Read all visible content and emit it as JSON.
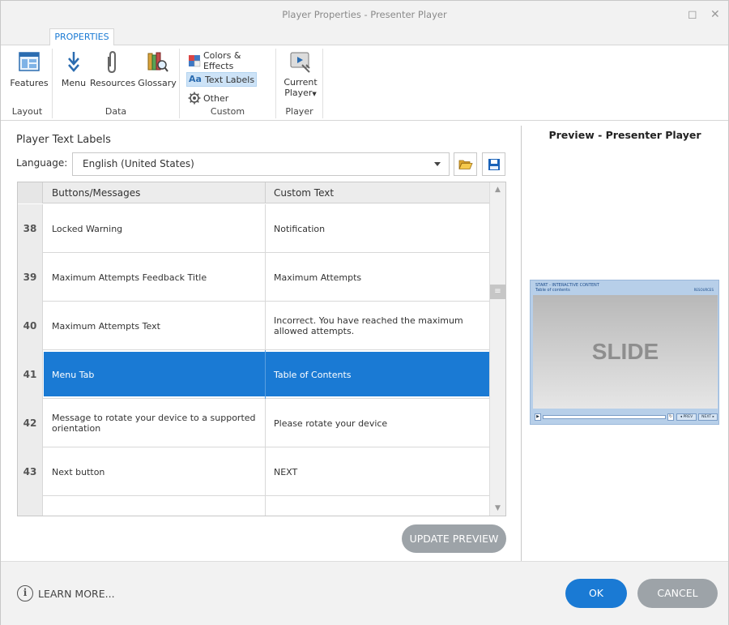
{
  "window": {
    "title": "Player Properties - Presenter Player"
  },
  "ribbon": {
    "tab": "PROPERTIES",
    "groups": {
      "layout": {
        "label": "Layout",
        "features": "Features"
      },
      "data": {
        "label": "Data",
        "menu": "Menu",
        "resources": "Resources",
        "glossary": "Glossary"
      },
      "custom": {
        "label": "Custom",
        "colors": "Colors & Effects",
        "text_labels": "Text Labels",
        "other": "Other"
      },
      "player": {
        "label": "Player",
        "current_line1": "Current",
        "current_line2": "Player"
      }
    }
  },
  "panel": {
    "title": "Player Text Labels",
    "language_label": "Language:",
    "language_value": "English (United States)"
  },
  "grid": {
    "col1": "Buttons/Messages",
    "col2": "Custom Text",
    "rows": [
      {
        "num": "38",
        "label": "Locked Warning",
        "text": "Notification"
      },
      {
        "num": "39",
        "label": "Maximum Attempts Feedback Title",
        "text": "Maximum Attempts"
      },
      {
        "num": "40",
        "label": "Maximum Attempts Text",
        "text": "Incorrect. You have reached the maximum allowed attempts."
      },
      {
        "num": "41",
        "label": "Menu Tab",
        "text": "Table of Contents"
      },
      {
        "num": "42",
        "label": "Message to rotate your device to a supported orientation",
        "text": "Please rotate your device"
      },
      {
        "num": "43",
        "label": "Next button",
        "text": "NEXT"
      }
    ],
    "selected_row": "41"
  },
  "update_preview": "UPDATE PREVIEW",
  "preview": {
    "title": "Preview - Presenter Player",
    "head1": "START - INTERACTIVE CONTENT",
    "head2": "Table of contents",
    "head3": "RESOURCES",
    "slide_text": "SLIDE",
    "prev": "◂ PREV",
    "next": "NEXT ▸"
  },
  "footer": {
    "learn_more": "LEARN MORE...",
    "ok": "OK",
    "cancel": "CANCEL"
  },
  "colors": {
    "accent": "#1a7ad4",
    "button_gray": "#9da3a8",
    "chrome": "#f2f2f2"
  }
}
